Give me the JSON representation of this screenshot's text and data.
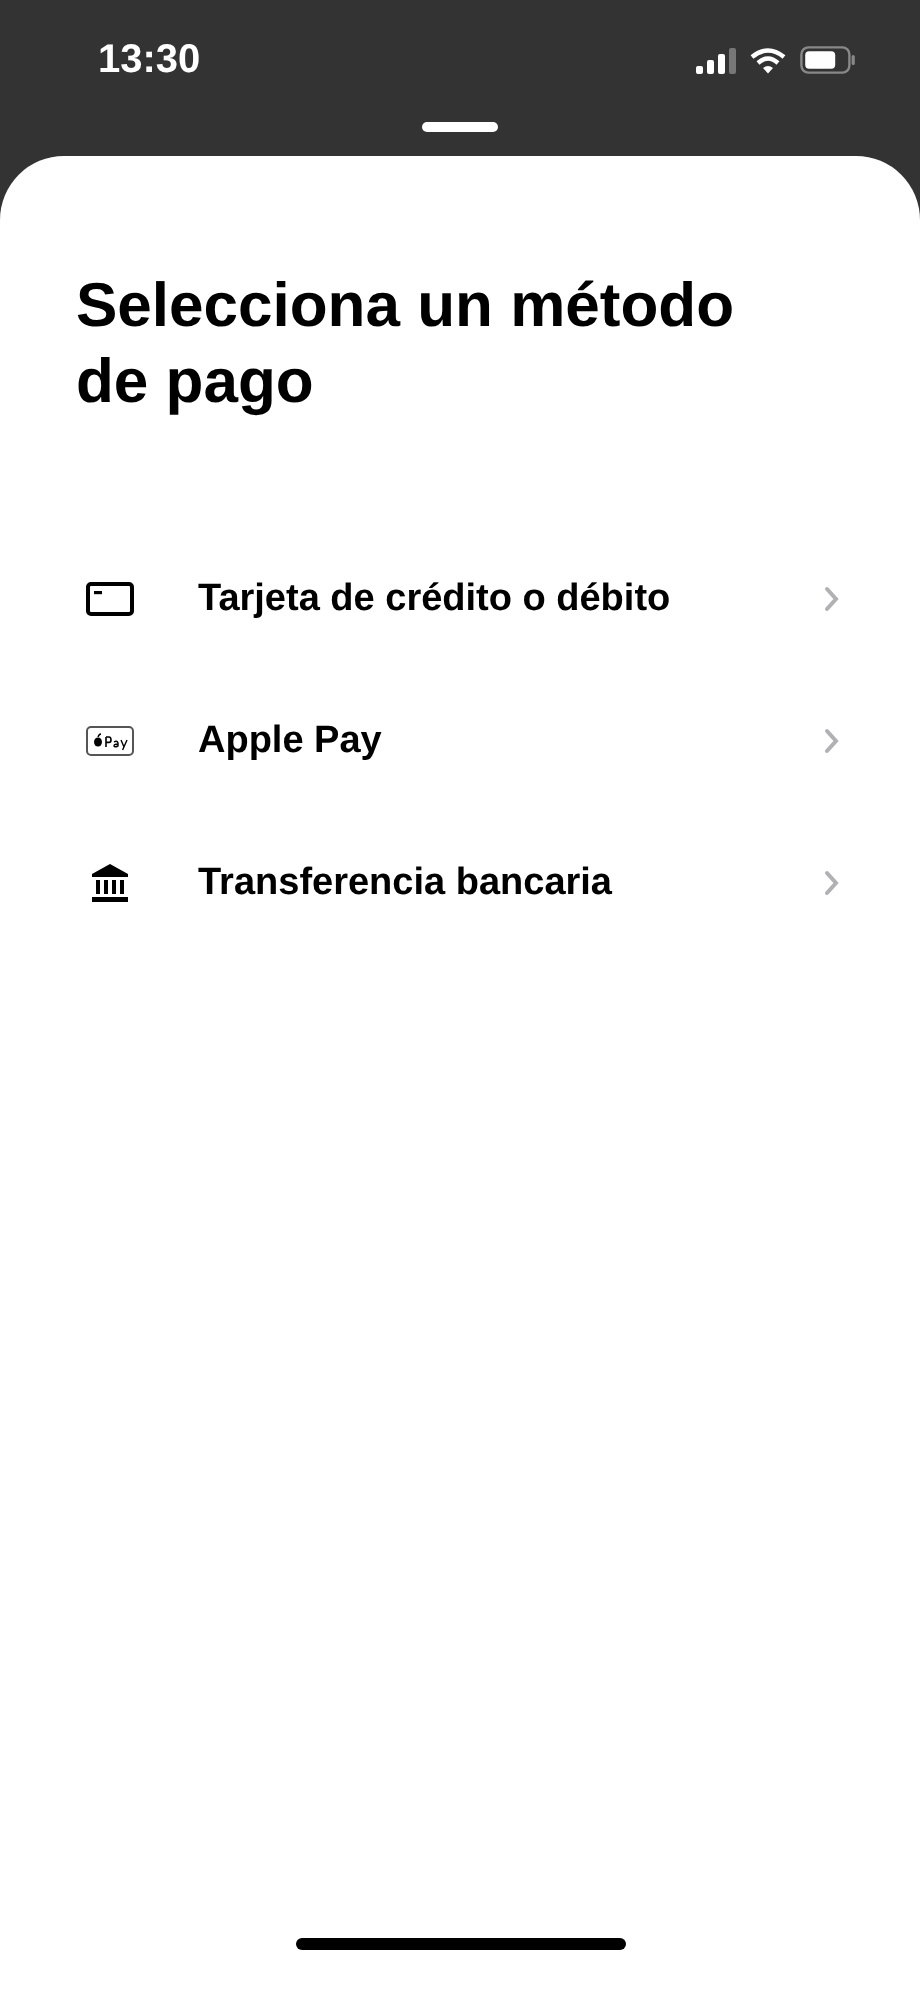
{
  "status_bar": {
    "time": "13:30"
  },
  "sheet": {
    "title": "Selecciona un método de pago",
    "methods": [
      {
        "kind": "card",
        "label": "Tarjeta de crédito o débito"
      },
      {
        "kind": "applepay",
        "label": "Apple Pay"
      },
      {
        "kind": "bank",
        "label": "Transferencia bancaria"
      }
    ]
  }
}
